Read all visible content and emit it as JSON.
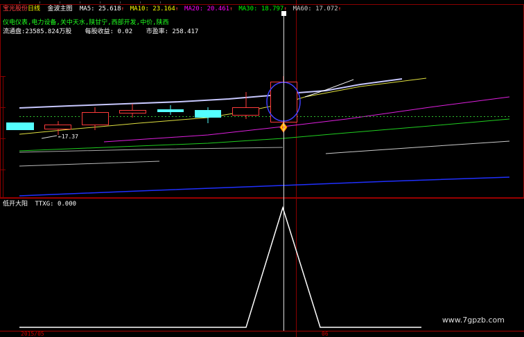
{
  "menu": [
    "",
    "",
    "",
    "",
    "",
    "",
    "",
    "",
    ""
  ],
  "header": {
    "stock_name": "宝光股份",
    "period": "日线",
    "indicator_name": "金波主图",
    "ma": [
      {
        "label": "MA5:",
        "value": "25.618",
        "arrow": "↑",
        "color": "#ffffff"
      },
      {
        "label": "MA10:",
        "value": "23.164",
        "arrow": "↑",
        "color": "#ffff00"
      },
      {
        "label": "MA20:",
        "value": "20.461",
        "arrow": "↑",
        "color": "#ff00ff"
      },
      {
        "label": "MA30:",
        "value": "18.797",
        "arrow": "↑",
        "color": "#00ff00"
      },
      {
        "label": "MA60:",
        "value": "17.072",
        "arrow": "↑",
        "color": "#cccccc"
      }
    ],
    "concepts": "仪电仪表,电力设备,关中天水,陕甘宁,西部开发,中价,陕西",
    "float_label": "流通盘:",
    "float_value": "23585.824万股",
    "eps_label": "每股收益:",
    "eps_value": "0.02",
    "pe_label": "市盈率:",
    "pe_value": "258.417"
  },
  "main_chart": {
    "low_marker": "←17.37",
    "colors": {
      "up": "#ff3b3b",
      "down": "#54ffff",
      "ma5": "#ffffff",
      "ma10": "#ffff00",
      "ma20": "#ff00ff",
      "ma30": "#00ff00",
      "ma60": "#cccccc",
      "long": "#2030ff"
    }
  },
  "sub_chart": {
    "title": "低开大阳",
    "value_label": "TTXG:",
    "value": "0.000"
  },
  "bottom": {
    "left_date": "2015/05",
    "mid_date": "06"
  },
  "watermark": "www.7gpzb.com"
}
